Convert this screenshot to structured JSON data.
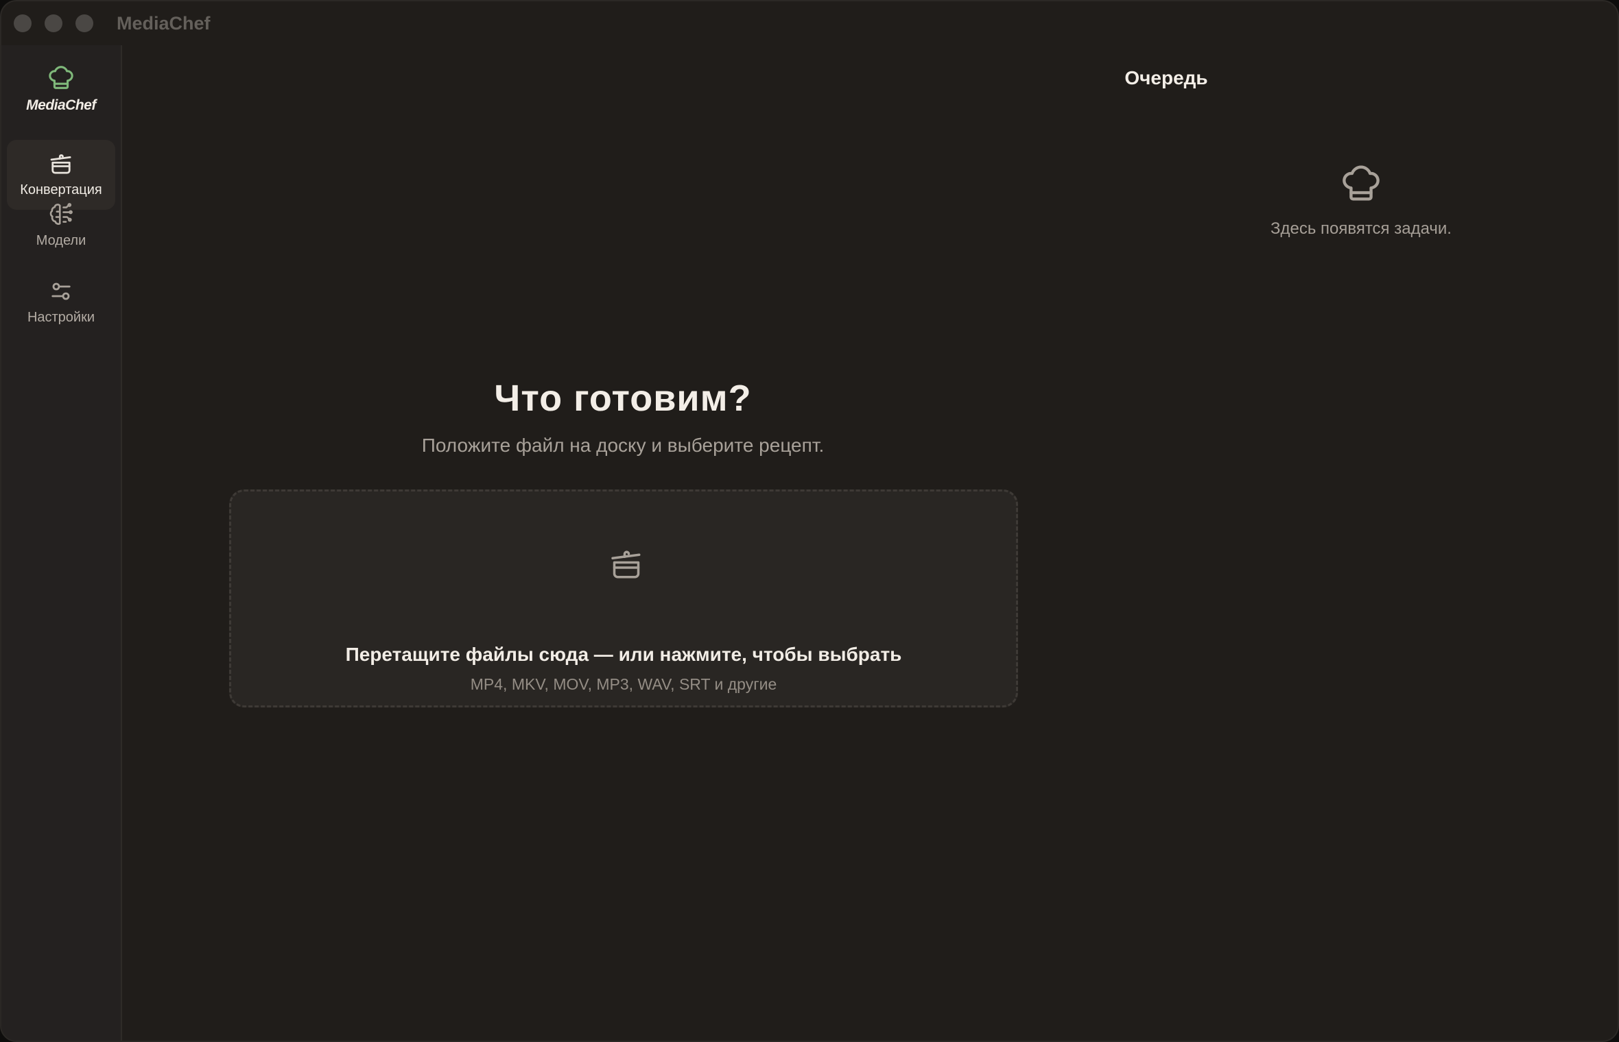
{
  "window": {
    "title": "MediaChef"
  },
  "sidebar": {
    "brand": "MediaChef",
    "items": [
      {
        "label": "Конвертация",
        "icon": "pot-icon",
        "active": true
      },
      {
        "label": "Модели",
        "icon": "brain-icon",
        "active": false
      },
      {
        "label": "Настройки",
        "icon": "sliders-icon",
        "active": false
      }
    ]
  },
  "main": {
    "heading": "Что готовим?",
    "subheading": "Положите файл на доску и выберите рецепт.",
    "dropzone": {
      "title": "Перетащите файлы сюда — или нажмите, чтобы выбрать",
      "formats": "MP4, MKV, MOV, MP3, WAV, SRT и другие"
    }
  },
  "queue": {
    "title": "Очередь",
    "empty_text": "Здесь появятся задачи."
  },
  "colors": {
    "background": "#201d1a",
    "sidebar": "#242120",
    "accent_green": "#7fb87a",
    "text_primary": "#f3eee7",
    "text_muted": "#a8a199"
  }
}
